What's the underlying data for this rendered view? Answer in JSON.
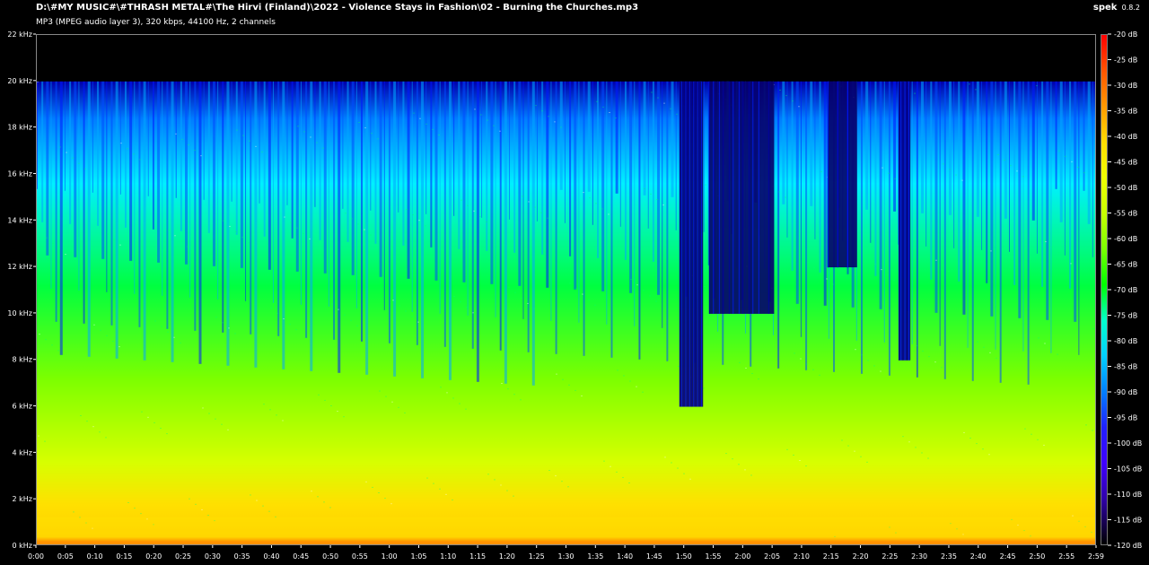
{
  "window": {
    "title": "D:\\#MY MUSIC#\\#THRASH METAL#\\The Hirvi (Finland)\\2022 - Violence Stays in Fashion\\02 - Burning the Churches.mp3",
    "info": "MP3 (MPEG audio layer 3), 320 kbps, 44100 Hz, 2 channels",
    "brand": "spek",
    "version": "0.8.2"
  },
  "axes": {
    "y_labels": [
      "22 kHz",
      "20 kHz",
      "18 kHz",
      "16 kHz",
      "14 kHz",
      "12 kHz",
      "10 kHz",
      "8 kHz",
      "6 kHz",
      "4 kHz",
      "2 kHz",
      "0 kHz"
    ],
    "x_labels": [
      "0:00",
      "0:05",
      "0:10",
      "0:15",
      "0:20",
      "0:25",
      "0:30",
      "0:35",
      "0:40",
      "0:45",
      "0:50",
      "0:55",
      "1:00",
      "1:05",
      "1:10",
      "1:15",
      "1:20",
      "1:25",
      "1:30",
      "1:35",
      "1:40",
      "1:45",
      "1:50",
      "1:55",
      "2:00",
      "2:05",
      "2:10",
      "2:15",
      "2:20",
      "2:25",
      "2:30",
      "2:35",
      "2:40",
      "2:45",
      "2:50",
      "2:55",
      "2:59"
    ],
    "db_labels": [
      "-20 dB",
      "-25 dB",
      "-30 dB",
      "-35 dB",
      "-40 dB",
      "-45 dB",
      "-50 dB",
      "-55 dB",
      "-60 dB",
      "-65 dB",
      "-70 dB",
      "-75 dB",
      "-80 dB",
      "-85 dB",
      "-90 dB",
      "-95 dB",
      "-100 dB",
      "-105 dB",
      "-110 dB",
      "-115 dB",
      "-120 dB"
    ]
  },
  "spectrogram": {
    "x_range": [
      0,
      179
    ],
    "y_range": [
      0,
      22
    ],
    "db_range": [
      -20,
      -120
    ],
    "cutoff_khz": 20,
    "low_frequency_floor_khz": 0.2,
    "dark_cut_regions": [
      {
        "start_sec": 108.5,
        "end_sec": 112.5,
        "top_khz": 20,
        "bottom_khz": 6
      },
      {
        "start_sec": 113.5,
        "end_sec": 124.5,
        "top_khz": 20,
        "bottom_khz": 10
      },
      {
        "start_sec": 133.5,
        "end_sec": 138.5,
        "top_khz": 20,
        "bottom_khz": 12
      },
      {
        "start_sec": 145.5,
        "end_sec": 147.5,
        "top_khz": 20,
        "bottom_khz": 8
      }
    ]
  },
  "theme": {
    "background": "#000000",
    "border": "#888888",
    "text": "#ffffff",
    "spectrogram_gradient": [
      "#0000ff",
      "#0080ff",
      "#00d0ff",
      "#00ffcc",
      "#00ff00",
      "#7cff00",
      "#c8ff00",
      "#f0ff00",
      "#ffdd00",
      "#ff9900",
      "#ff5500",
      "#ff0000"
    ]
  }
}
